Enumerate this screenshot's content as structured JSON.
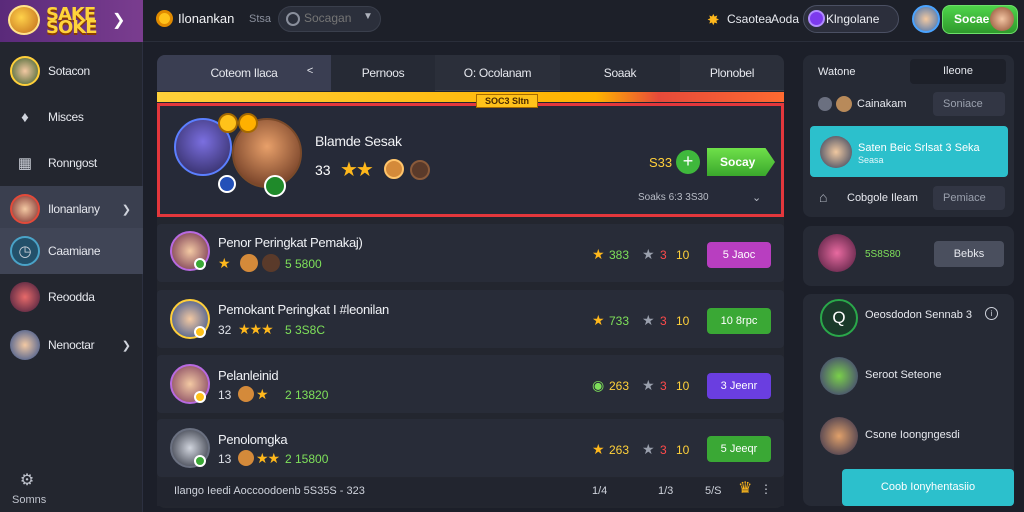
{
  "app": {
    "logo_text": "SAKE SOKE",
    "brand": "Ilonankan",
    "sep_text": "Stsa"
  },
  "search": {
    "placeholder": "Socagan"
  },
  "topbar": {
    "link1": "Csaotea",
    "link2": "Aoda",
    "user_label": "Klngolane",
    "cta_label": "Socae"
  },
  "sidebar": {
    "items": [
      {
        "label": "Sotacon"
      },
      {
        "label": "Misces"
      },
      {
        "label": "Ronngost"
      },
      {
        "label": "Ilonanlany"
      },
      {
        "label": "Caamiane"
      },
      {
        "label": "Reoodda"
      },
      {
        "label": "Nenoctar"
      }
    ],
    "settings_label": "Somns"
  },
  "tabs": [
    "Coteom Ilaca",
    "Pernoos",
    "O: Ocolanam",
    "Soaak",
    "Plonobel"
  ],
  "featured": {
    "tag": "SOC3 Sltn",
    "name": "Blamde Sesak",
    "score": "33",
    "stars": "★★",
    "stat_num": "S33",
    "play_label": "Socay",
    "meta": "Soaks 6:3 3S30"
  },
  "rows": [
    {
      "name": "Penor Peringkat  Pemakaj)",
      "level": "",
      "stars": "★",
      "points": "5 5800",
      "s1": "383",
      "s2": "3",
      "s3": "10",
      "button": "5 Jaoc",
      "button_color": "#b83ec0"
    },
    {
      "name": "Pemokant Peringkat I #leonilan",
      "level": "32",
      "stars": "★★★",
      "points": "5 3S8C",
      "s1": "733",
      "s2": "3",
      "s3": "10",
      "button": "10 8rpc",
      "button_color": "#3aa835"
    },
    {
      "name": "Pelanleinid",
      "level": "13",
      "stars": "★",
      "points": "2 13820",
      "s1": "263",
      "s2": "3",
      "s3": "10",
      "button": "3 Jeenr",
      "button_color": "#6a3ee0"
    },
    {
      "name": "Penolomgka",
      "level": "13",
      "stars": "★★",
      "points": "2 15800",
      "s1": "263",
      "s2": "3",
      "s3": "10",
      "button": "5 Jeeqr",
      "button_color": "#3aa835"
    }
  ],
  "footer": {
    "text": "Ilango Ieedi Aoccoodoenb 5S35S - 323",
    "s1": "1/4",
    "s2": "1/3",
    "s3": "5/S"
  },
  "right": {
    "tab0": "Watone",
    "tab1": "Ileone",
    "line1": "Cainakam",
    "drop1": "Soniace",
    "highlight_title": "Saten Beic Srlsat 3 Seka",
    "highlight_sub": "Seasa",
    "line2": "Cobgole Ileam",
    "drop2": "Pemiace",
    "card2_pts": "5S8S80",
    "card2_btn": "Bebks",
    "q_label": "Oeosdodon Sennab 3",
    "friend1": "Seroot Seteone",
    "friend2": "Csone Ioongngesdi",
    "cta": "Coob Ionyhentasiio"
  }
}
